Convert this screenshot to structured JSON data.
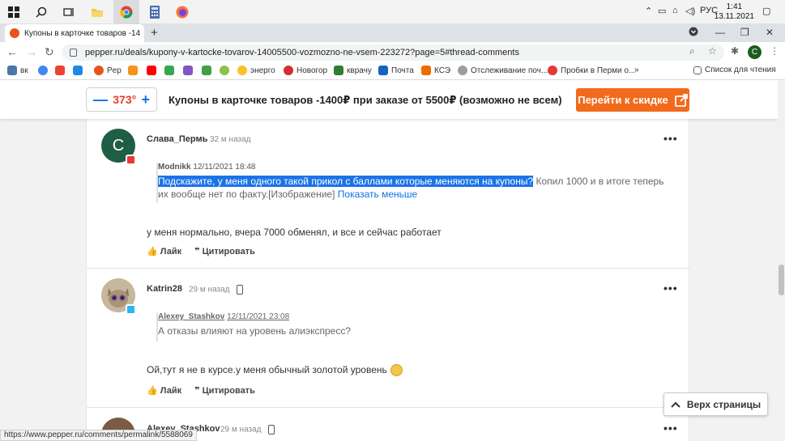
{
  "taskbar": {
    "time": "1:41",
    "date": "13.11.2021",
    "lang": "РУС"
  },
  "browser": {
    "tab_title": "Купоны в карточке товаров -14",
    "url": "pepper.ru/deals/kupony-v-kartocke-tovarov-14005500-vozmozno-ne-vsem-223272?page=5#thread-comments",
    "profile_letter": "С",
    "bookmarks": [
      "вк",
      "Pep",
      "энерго",
      "Новогор",
      "кврачу",
      "Почта",
      "КСЭ",
      "Отслеживание поч...",
      "Пробки в Перми о..."
    ],
    "reading_list": "Список для чтения",
    "status_url": "https://www.pepper.ru/comments/permalink/5588069"
  },
  "deal": {
    "temperature": "373°",
    "minus": "—",
    "plus": "+",
    "title": "Купоны в карточке товаров -1400₽ при заказе от 5500₽ (возможно не всем)",
    "goto_label": "Перейти к скидке"
  },
  "comments": [
    {
      "avatar_letter": "С",
      "author": "Слава_Пермь",
      "time": "32 м назад",
      "quote_author": "Modnikk",
      "quote_date": "12/11/2021 18:48",
      "quote_highlighted": "Подскажите, у меня одного такой прикол с баллами которые меняются на купоны?",
      "quote_rest": " Копил 1000 и в итоге теперь их вообще нет по факту.[Изображение] ",
      "quote_link": "Показать меньше",
      "text": "у меня нормально, вчера 7000 обменял, и все и сейчас работает",
      "like": "Лайк",
      "cite": "Цитировать"
    },
    {
      "author": "Katrin28",
      "time": "29 м назад",
      "quote_author": "Alexey_Stashkov",
      "quote_date": "12/11/2021 23:08",
      "quote_text": "А отказы влияют на уровень алиэкспресс?",
      "text": "Ой,тут я не в курсе.у меня обычный золотой уровень",
      "like": "Лайк",
      "cite": "Цитировать"
    },
    {
      "author": "Alexey_Stashkov",
      "time": "29 м назад"
    }
  ],
  "scroll_top_label": "Верх страницы"
}
